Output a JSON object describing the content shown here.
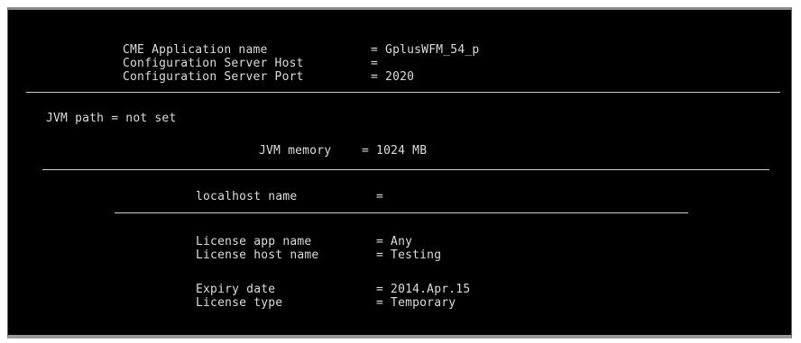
{
  "config": {
    "cme_label": "CME Application name",
    "cme_value": "= GplusWFM_54_p",
    "host_label": "Configuration Server Host",
    "host_value": "=",
    "port_label": "Configuration Server Port",
    "port_value": "= 2020"
  },
  "jvm": {
    "path_line": "JVM path = not set",
    "memory_label": "JVM memory",
    "memory_value": "= 1024 MB"
  },
  "localhost": {
    "label": "localhost name",
    "value": "="
  },
  "license": {
    "app_label": "License app name",
    "app_value": "= Any",
    "host_label": "License host name",
    "host_value": "= Testing",
    "expiry_label": "Expiry date",
    "expiry_value": "= 2014.Apr.15",
    "type_label": "License type",
    "type_value": "= Temporary"
  },
  "colors": {
    "background": "#000000",
    "text": "#dcdcdc",
    "rule": "#cfcfcf",
    "frame": "#8a8a8a"
  }
}
